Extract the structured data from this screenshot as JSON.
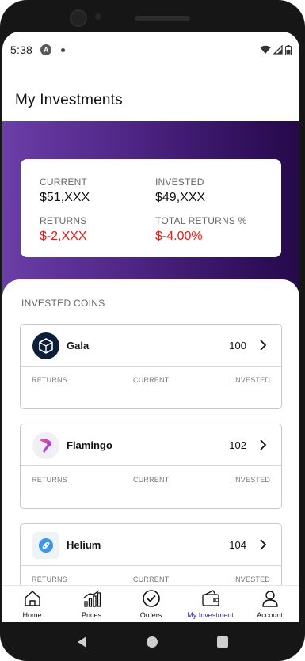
{
  "status_bar": {
    "time": "5:38",
    "app_badge": "A"
  },
  "header": {
    "title": "My Investments"
  },
  "summary": {
    "current_label": "CURRENT",
    "current_value": "$51,XXX",
    "invested_label": "INVESTED",
    "invested_value": "$49,XXX",
    "returns_label": "RETURNS",
    "returns_value": "$-2,XXX",
    "total_returns_label": "TOTAL RETURNS %",
    "total_returns_value": "$-4.00%"
  },
  "coins_section": {
    "title": "INVESTED COINS",
    "columns": [
      "RETURNS",
      "CURRENT",
      "INVESTED"
    ],
    "coins": [
      {
        "name": "Gala",
        "quantity": "100",
        "icon": "gala-logo-icon"
      },
      {
        "name": "Flamingo",
        "quantity": "102",
        "icon": "flamingo-logo-icon"
      },
      {
        "name": "Helium",
        "quantity": "104",
        "icon": "helium-logo-icon"
      }
    ]
  },
  "bottom_nav": {
    "items": [
      {
        "label": "Home",
        "icon": "home-icon"
      },
      {
        "label": "Prices",
        "icon": "prices-icon"
      },
      {
        "label": "Orders",
        "icon": "orders-icon"
      },
      {
        "label": "My Investment",
        "icon": "wallet-icon"
      },
      {
        "label": "Account",
        "icon": "account-icon"
      }
    ],
    "active_index": 3
  },
  "colors": {
    "accent": "#2a22c9",
    "negative": "#e0201b",
    "banner_start": "#6b3ea8",
    "banner_end": "#250a4a"
  }
}
